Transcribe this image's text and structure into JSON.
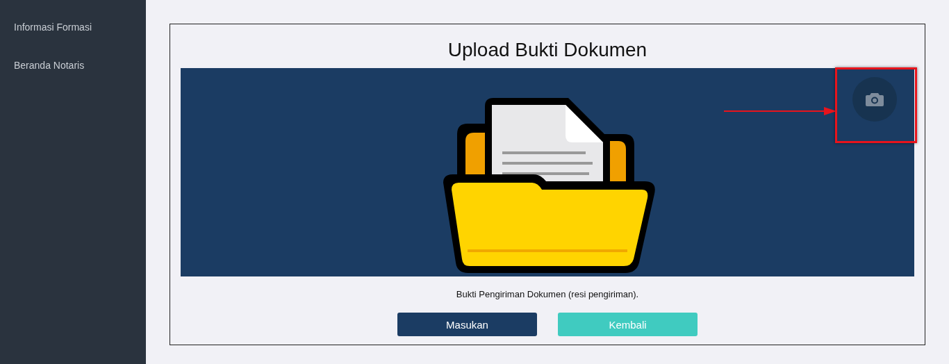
{
  "sidebar": {
    "items": [
      {
        "label": "Informasi Formasi"
      },
      {
        "label": "Beranda Notaris"
      }
    ]
  },
  "card": {
    "title": "Upload Bukti Dokumen",
    "caption": "Bukti Pengiriman Dokumen (resi pengiriman).",
    "buttons": [
      {
        "label": "Masukan",
        "kind": "primary"
      },
      {
        "label": "Kembali",
        "kind": "secondary"
      }
    ]
  }
}
